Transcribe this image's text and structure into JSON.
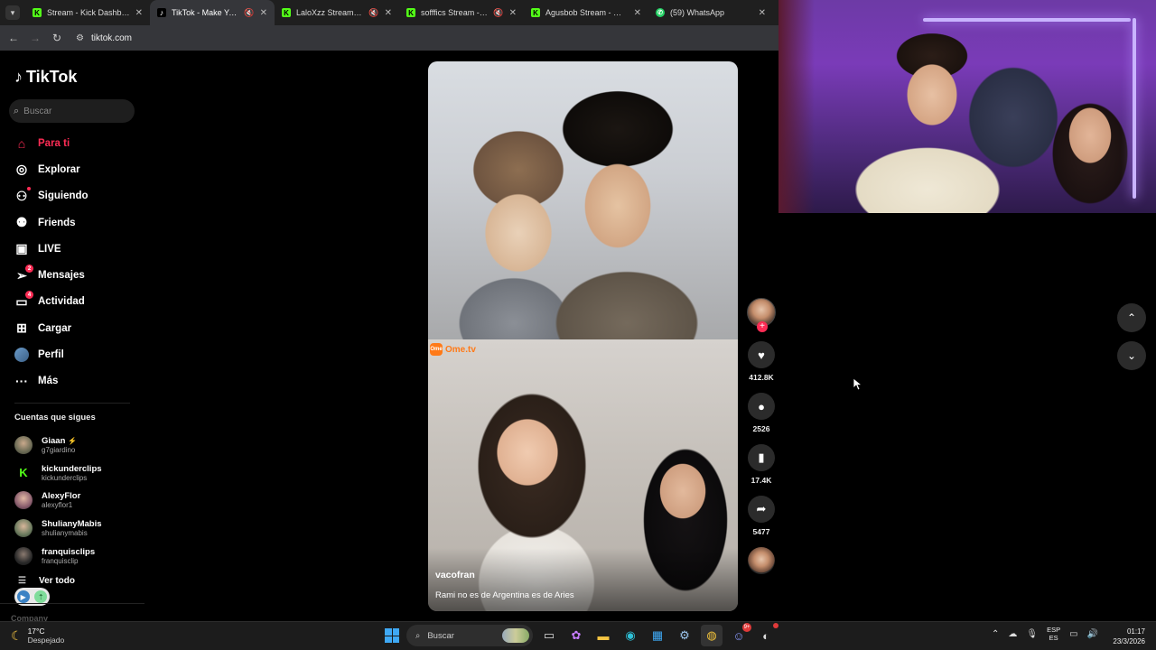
{
  "browser": {
    "tabs": [
      {
        "title": "Stream - Kick Dashboard",
        "favicon": "kick",
        "active": false,
        "muted": false
      },
      {
        "title": "TikTok - Make Your Day",
        "favicon": "tiktok",
        "active": true,
        "muted": true
      },
      {
        "title": "LaloXzz Stream - Watch",
        "favicon": "kick",
        "active": false,
        "muted": true
      },
      {
        "title": "sofffics Stream - Watch",
        "favicon": "kick",
        "active": false,
        "muted": true
      },
      {
        "title": "Agusbob Stream - Watch",
        "favicon": "kick",
        "active": false,
        "muted": false
      },
      {
        "title": "(59) WhatsApp",
        "favicon": "whatsapp",
        "active": false,
        "muted": false
      }
    ],
    "url": "tiktok.com"
  },
  "tiktok": {
    "logo_text": "TikTok",
    "search_placeholder": "Buscar",
    "nav": [
      {
        "label": "Para ti",
        "icon": "home-icon",
        "active": true
      },
      {
        "label": "Explorar",
        "icon": "compass-icon"
      },
      {
        "label": "Siguiendo",
        "icon": "following-icon"
      },
      {
        "label": "Friends",
        "icon": "friends-icon"
      },
      {
        "label": "LIVE",
        "icon": "live-icon"
      },
      {
        "label": "Mensajes",
        "icon": "messages-icon",
        "badge": "2"
      },
      {
        "label": "Actividad",
        "icon": "activity-icon",
        "badge": "4"
      },
      {
        "label": "Cargar",
        "icon": "upload-icon"
      },
      {
        "label": "Perfil",
        "icon": "avatar"
      },
      {
        "label": "Más",
        "icon": "more-icon"
      }
    ],
    "following_title": "Cuentas que sigues",
    "following": [
      {
        "name": "Giaan",
        "handle": "g7giardino",
        "color": "#6b6b55",
        "emoji": "⚡"
      },
      {
        "name": "kickunderclips",
        "handle": "kickunderclips",
        "color": "#000000",
        "logo": "K"
      },
      {
        "name": "AlexyFlor",
        "handle": "alexyflor1",
        "color": "#8a5e6e"
      },
      {
        "name": "ShulianyMabis",
        "handle": "shulianymabis",
        "color": "#6a7a5e"
      },
      {
        "name": "franquisclips",
        "handle": "franquisclip",
        "color": "#2a2a2a"
      }
    ],
    "see_all": "Ver todo",
    "company": "Company",
    "video": {
      "watermark": "Ome.tv",
      "author": "vacofran",
      "caption": "Rami no es de Argentina es de Aries",
      "likes": "412.8K",
      "comments": "2526",
      "saves": "17.4K",
      "shares": "5477"
    }
  },
  "taskbar": {
    "temperature": "17°C",
    "weather": "Despejado",
    "search_placeholder": "Buscar",
    "lang_top": "ESP",
    "lang_bottom": "ES",
    "time": "01:17",
    "date": "23/3/2026",
    "discord_badge": "9+"
  },
  "colors": {
    "accent": "#fe2c55",
    "kick": "#53fc18"
  }
}
